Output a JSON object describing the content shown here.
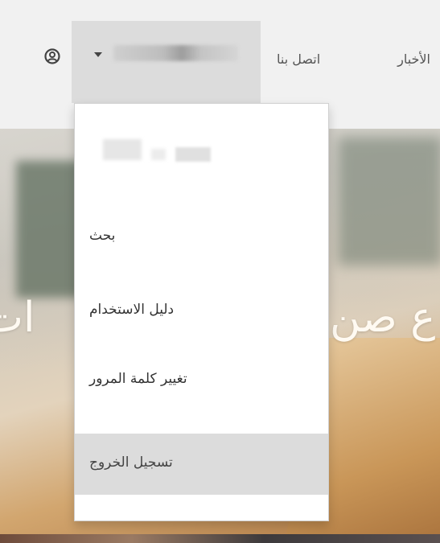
{
  "nav": {
    "news_label": "الأخبار",
    "contact_label": "اتصل بنا",
    "username": ""
  },
  "hero": {
    "heading_left": "ات",
    "heading_right": "ع صن"
  },
  "dropdown": {
    "items": [
      {
        "label": "بحث"
      },
      {
        "label": "دليل الاستخدام"
      },
      {
        "label": "تغيير كلمة المرور"
      },
      {
        "label": "تسجيل الخروج"
      }
    ]
  },
  "icons": {
    "user": "user-circle-icon",
    "caret": "caret-down-icon"
  }
}
